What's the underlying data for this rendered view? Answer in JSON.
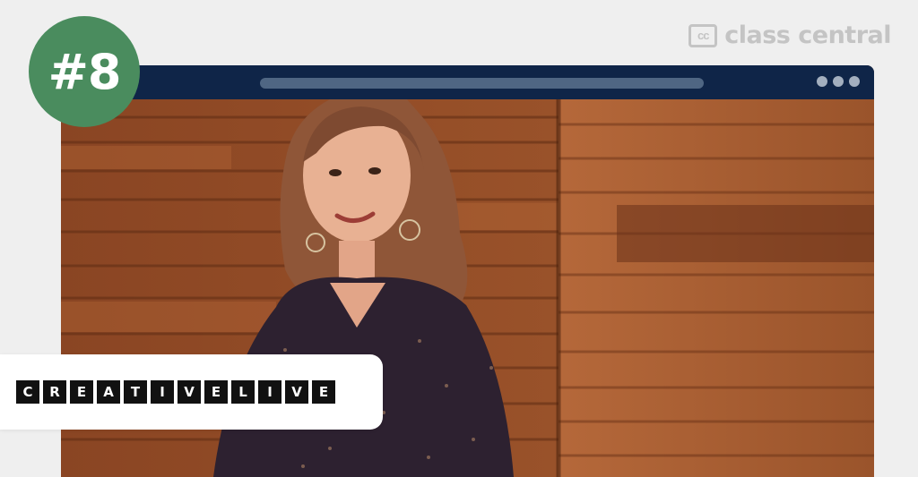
{
  "brand": {
    "icon_text": "cc",
    "name": "class central"
  },
  "rank": {
    "label": "#8"
  },
  "window": {
    "icon": "more-dots-icon"
  },
  "provider": {
    "name": "CREATIVELIVE"
  },
  "colors": {
    "badge": "#4a8c5e",
    "titlebar": "#0f2548",
    "address_bar": "#4f6683",
    "brand_gray": "#c4c4c4"
  }
}
